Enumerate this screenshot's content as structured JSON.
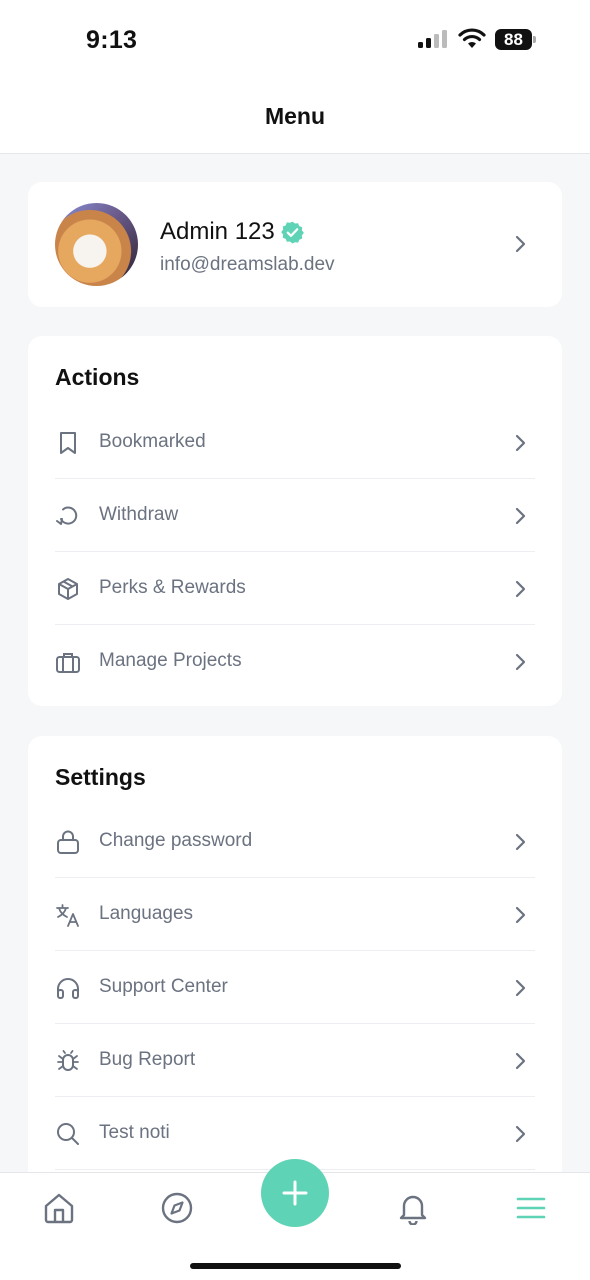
{
  "status_bar": {
    "time": "9:13",
    "battery": "88"
  },
  "header": {
    "title": "Menu"
  },
  "profile": {
    "name": "Admin 123",
    "email": "info@dreamslab.dev"
  },
  "actions": {
    "title": "Actions",
    "items": [
      {
        "label": "Bookmarked",
        "icon": "bookmark-icon"
      },
      {
        "label": "Withdraw",
        "icon": "refresh-icon"
      },
      {
        "label": "Perks & Rewards",
        "icon": "box-icon"
      },
      {
        "label": "Manage Projects",
        "icon": "briefcase-icon"
      }
    ]
  },
  "settings": {
    "title": "Settings",
    "items": [
      {
        "label": "Change password",
        "icon": "lock-icon"
      },
      {
        "label": "Languages",
        "icon": "translate-icon"
      },
      {
        "label": "Support Center",
        "icon": "headphones-icon"
      },
      {
        "label": "Bug Report",
        "icon": "bug-icon"
      },
      {
        "label": "Test noti",
        "icon": "search-icon"
      }
    ]
  },
  "tabbar": {
    "tabs": [
      "home-icon",
      "compass-icon",
      "add-icon",
      "bell-icon",
      "menu-icon"
    ],
    "active": "menu-icon"
  },
  "colors": {
    "accent": "#5fd3b5",
    "muted_text": "#6b7280",
    "icon": "#6b7280"
  }
}
